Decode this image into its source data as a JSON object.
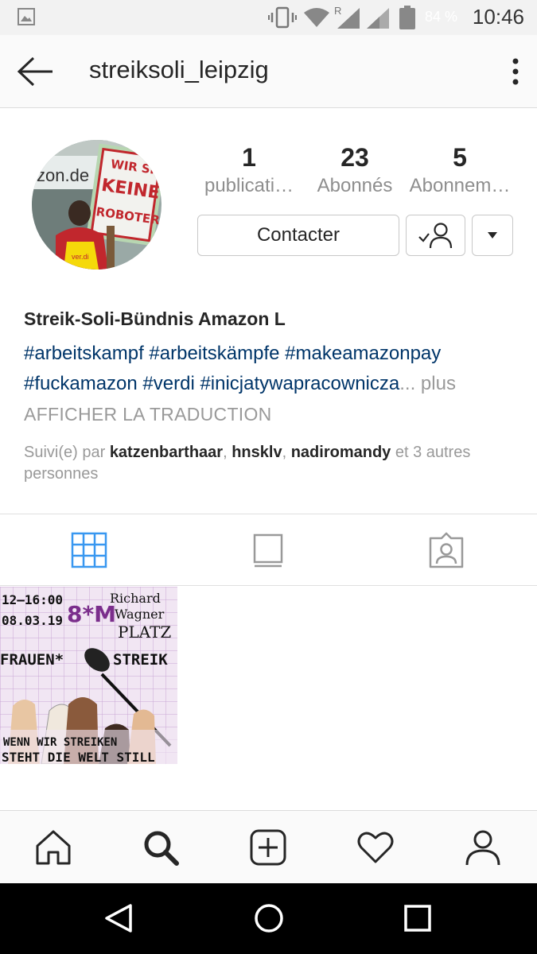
{
  "status_bar": {
    "battery": "84 %",
    "time": "10:46",
    "network_label": "R"
  },
  "appbar": {
    "username": "streiksoli_leipzig"
  },
  "profile": {
    "stats": [
      {
        "value": "1",
        "label": "publicati…"
      },
      {
        "value": "23",
        "label": "Abonnés"
      },
      {
        "value": "5",
        "label": "Abonnem…"
      }
    ],
    "contact_button": "Contacter",
    "display_name": "Streik-Soli-Bündnis Amazon L",
    "hashtags_line1": "#arbeitskampf #arbeitskämpfe #makeamazonpay",
    "hashtags_line2": "#fuckamazon #verdi #inicjatywapracownicza",
    "ellipsis": "...",
    "more_label": "plus",
    "translate_label": "AFFICHER LA TRADUCTION",
    "followed_prefix": "Suivi(e) par ",
    "followers": [
      "katzenbarthaar",
      "hnsklv",
      "nadiromandy"
    ],
    "followed_sep": ", ",
    "followed_suffix": " et 3 autres personnes"
  },
  "avatar_sign": {
    "store_text": "zon.de",
    "line1": "WIR SIND",
    "line2": "KEINE",
    "line3": "ROBOTER",
    "vest_text": "ver.di"
  },
  "post": {
    "time": "12–16:00",
    "date": "08.03.19",
    "symbol": "8*M",
    "place_line1": "Richard",
    "place_line2": "Wagner",
    "place_line3": "PLATZ",
    "headline_left": "FRAUEN*",
    "headline_right": "STREIK",
    "footer_line1": "WENN WIR STREIKEN",
    "footer_line2": "STEHT DIE WELT STILL"
  },
  "colors": {
    "link_blue": "#003569",
    "active_tab": "#3897f0",
    "muted": "#999999",
    "post_purple": "#7b2e8c"
  },
  "icons": {
    "tabs": [
      "grid-icon",
      "feed-icon",
      "tagged-icon"
    ],
    "bottom_nav": [
      "home-icon",
      "search-icon",
      "add-post-icon",
      "heart-icon",
      "profile-icon"
    ]
  }
}
